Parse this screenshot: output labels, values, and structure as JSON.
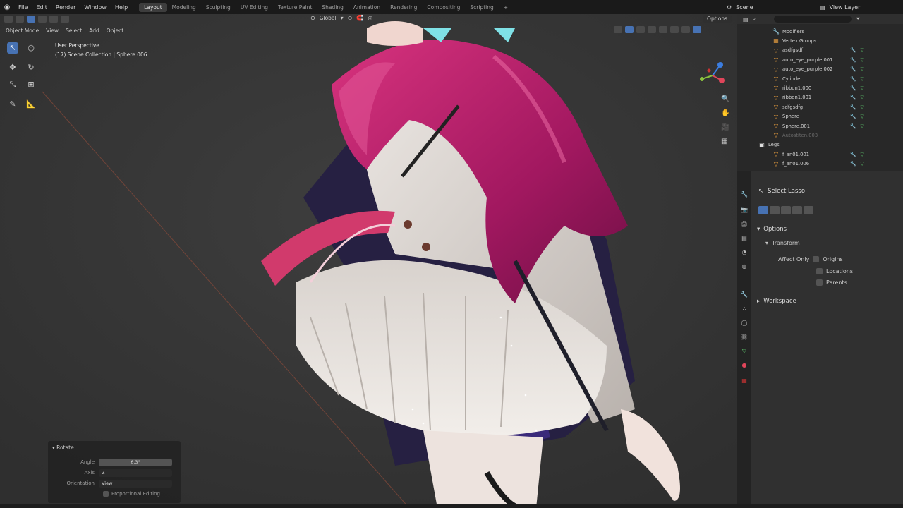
{
  "menu": {
    "items": [
      "File",
      "Edit",
      "Render",
      "Window",
      "Help"
    ],
    "workspaces": [
      "Layout",
      "Modeling",
      "Sculpting",
      "UV Editing",
      "Texture Paint",
      "Shading",
      "Animation",
      "Rendering",
      "Compositing",
      "Scripting",
      "+"
    ],
    "active_workspace": "Layout",
    "scene": "Scene",
    "view_layer": "View Layer"
  },
  "viewport": {
    "mode": "Object Mode",
    "menus": [
      "View",
      "Select",
      "Add",
      "Object"
    ],
    "transform_orientation": "Global",
    "options_label": "Options",
    "perspective": "User Perspective",
    "collection_info": "(17) Scene Collection | Sphere.006"
  },
  "rotate_panel": {
    "title": "Rotate",
    "angle_label": "Angle",
    "angle_value": "6.3°",
    "axis_label": "Axis",
    "axis_value": "Z",
    "orientation_label": "Orientation",
    "orientation_value": "View",
    "proportional_label": "Proportional Editing"
  },
  "outliner": {
    "items": [
      {
        "label": "Modifiers",
        "kind": "mod"
      },
      {
        "label": "Vertex Groups",
        "kind": "grp"
      },
      {
        "label": "asdfgsdf",
        "kind": "obj"
      },
      {
        "label": "auto_eye_purple.001",
        "kind": "obj"
      },
      {
        "label": "auto_eye_purple.002",
        "kind": "obj"
      },
      {
        "label": "Cylinder",
        "kind": "obj"
      },
      {
        "label": "ribbon1.000",
        "kind": "obj"
      },
      {
        "label": "ribbon1.001",
        "kind": "obj"
      },
      {
        "label": "sdfgsdfg",
        "kind": "obj"
      },
      {
        "label": "Sphere",
        "kind": "obj"
      },
      {
        "label": "Sphere.001",
        "kind": "obj"
      },
      {
        "label": "Autostiten.003",
        "kind": "dim"
      },
      {
        "label": "Legs",
        "kind": "col"
      },
      {
        "label": "f_an01.001",
        "kind": "obj"
      },
      {
        "label": "f_an01.006",
        "kind": "obj"
      }
    ]
  },
  "properties": {
    "tool_name": "Select Lasso",
    "options": "Options",
    "transform": "Transform",
    "affect_only": "Affect Only",
    "origins": "Origins",
    "locations": "Locations",
    "parents": "Parents",
    "workspace": "Workspace"
  }
}
